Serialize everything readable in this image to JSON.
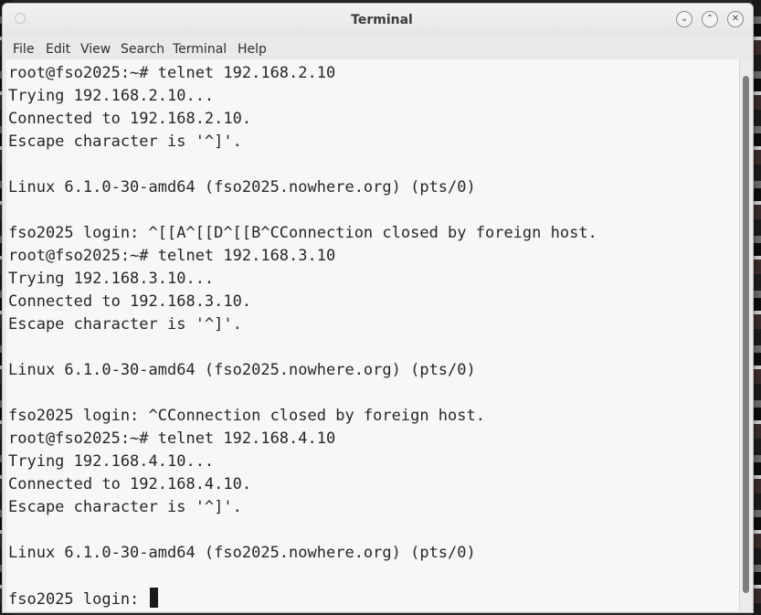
{
  "window": {
    "title": "Terminal",
    "controls": {
      "minimize": "⌄",
      "maximize": "⌃",
      "close": "✕"
    }
  },
  "menu": {
    "items": [
      "File",
      "Edit",
      "View",
      "Search",
      "Terminal",
      "Help"
    ]
  },
  "terminal": {
    "lines": [
      "root@fso2025:~# telnet 192.168.2.10",
      "Trying 192.168.2.10...",
      "Connected to 192.168.2.10.",
      "Escape character is '^]'.",
      "",
      "Linux 6.1.0-30-amd64 (fso2025.nowhere.org) (pts/0)",
      "",
      "fso2025 login: ^[[A^[[D^[[B^CConnection closed by foreign host.",
      "root@fso2025:~# telnet 192.168.3.10",
      "Trying 192.168.3.10...",
      "Connected to 192.168.3.10.",
      "Escape character is '^]'.",
      "",
      "Linux 6.1.0-30-amd64 (fso2025.nowhere.org) (pts/0)",
      "",
      "fso2025 login: ^CConnection closed by foreign host.",
      "root@fso2025:~# telnet 192.168.4.10",
      "Trying 192.168.4.10...",
      "Connected to 192.168.4.10.",
      "Escape character is '^]'.",
      "",
      "Linux 6.1.0-30-amd64 (fso2025.nowhere.org) (pts/0)",
      "",
      "fso2025 login: "
    ]
  },
  "colors": {
    "terminal_bg": "#f7f7f7",
    "terminal_fg": "#262626",
    "cursor": "#1a1a1a"
  }
}
